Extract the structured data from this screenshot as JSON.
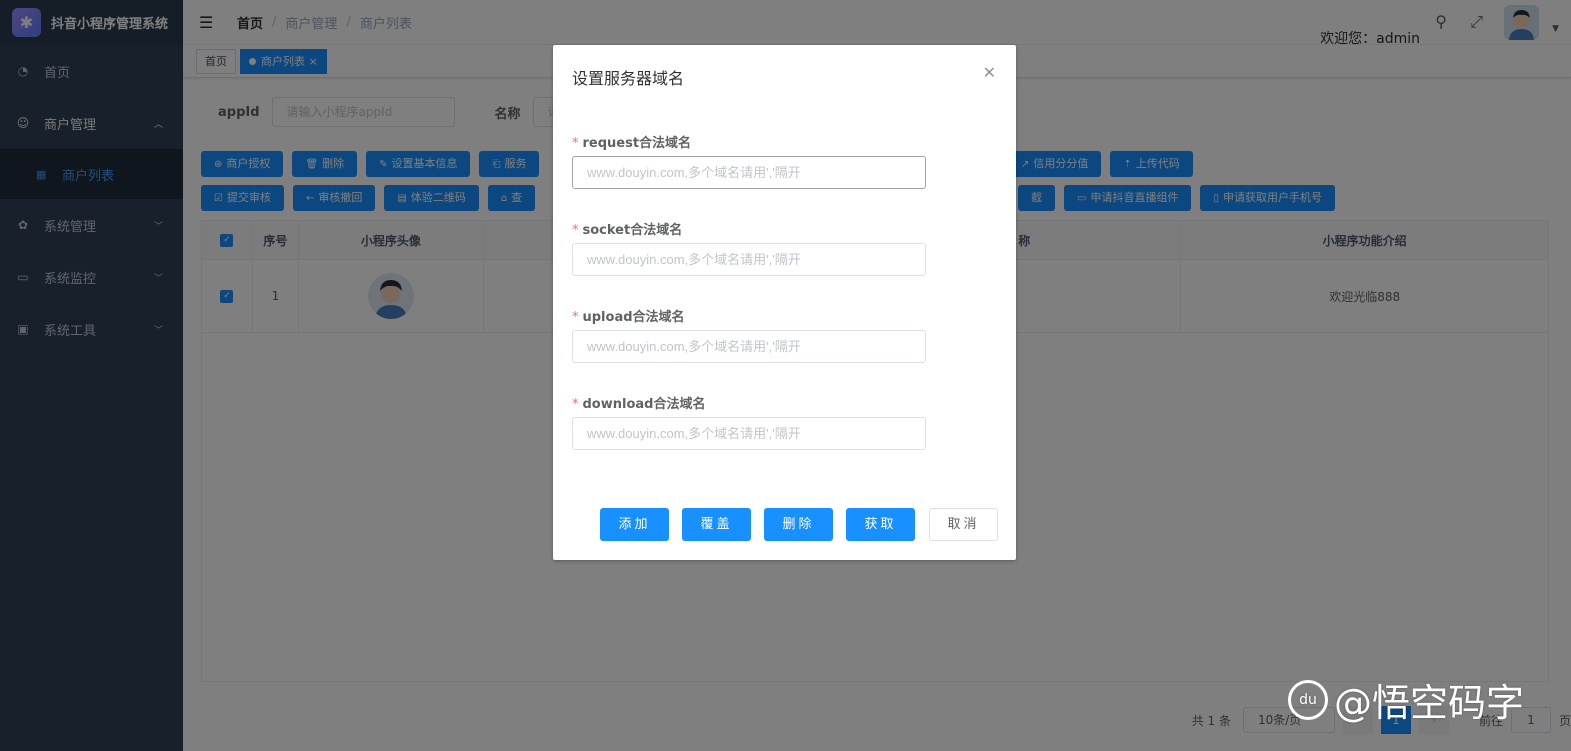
{
  "app": {
    "title": "抖音小程序管理系统"
  },
  "sidebar": {
    "items": [
      {
        "label": "首页",
        "icon": "dashboard-icon"
      },
      {
        "label": "商户管理",
        "icon": "merchant-icon"
      },
      {
        "label": "商户列表",
        "icon": "grid-icon"
      },
      {
        "label": "系统管理",
        "icon": "gear-icon"
      },
      {
        "label": "系统监控",
        "icon": "monitor-icon"
      },
      {
        "label": "系统工具",
        "icon": "toolbox-icon"
      }
    ]
  },
  "navbar": {
    "breadcrumb": [
      "首页",
      "商户管理",
      "商户列表"
    ],
    "welcome": "欢迎您：admin"
  },
  "tags": [
    "首页",
    "商户列表"
  ],
  "search": {
    "appid_label": "appId",
    "appid_placeholder": "请输入小程序appId",
    "name_label": "名称",
    "name_placeholder": "请"
  },
  "toolbar": {
    "row1": [
      "商户授权",
      "删除",
      "设置基本信息",
      "服务",
      "信用分分值",
      "上传代码"
    ],
    "row2": [
      "提交审核",
      "审核撤回",
      "体验二维码",
      "查",
      "截",
      "申请抖音直播组件",
      "申请获取用户手机号"
    ]
  },
  "table": {
    "headers": [
      "序号",
      "小程序头像",
      "称",
      "小程序功能介绍"
    ],
    "rows": [
      {
        "index": "1",
        "intro": "欢迎光临888"
      }
    ]
  },
  "pagination": {
    "total": "共 1 条",
    "page_size": "10条/页",
    "current": "1",
    "jump_label": "前往",
    "jump_value": "1",
    "page_suffix": "页"
  },
  "dialog": {
    "title": "设置服务器域名",
    "fields": [
      {
        "label": "request合法域名",
        "placeholder": "www.douyin.com,多个域名请用','隔开"
      },
      {
        "label": "socket合法域名",
        "placeholder": "www.douyin.com,多个域名请用','隔开"
      },
      {
        "label": "upload合法域名",
        "placeholder": "www.douyin.com,多个域名请用','隔开"
      },
      {
        "label": "download合法域名",
        "placeholder": "www.douyin.com,多个域名请用','隔开"
      }
    ],
    "buttons": {
      "add": "添加",
      "cover": "覆盖",
      "delete": "删除",
      "fetch": "获取",
      "cancel": "取消"
    }
  },
  "watermark": {
    "text": "@悟空码字",
    "badge": "du"
  },
  "colors": {
    "primary": "#1890ff",
    "sidebar": "#304156",
    "required": "#f56c6c"
  }
}
